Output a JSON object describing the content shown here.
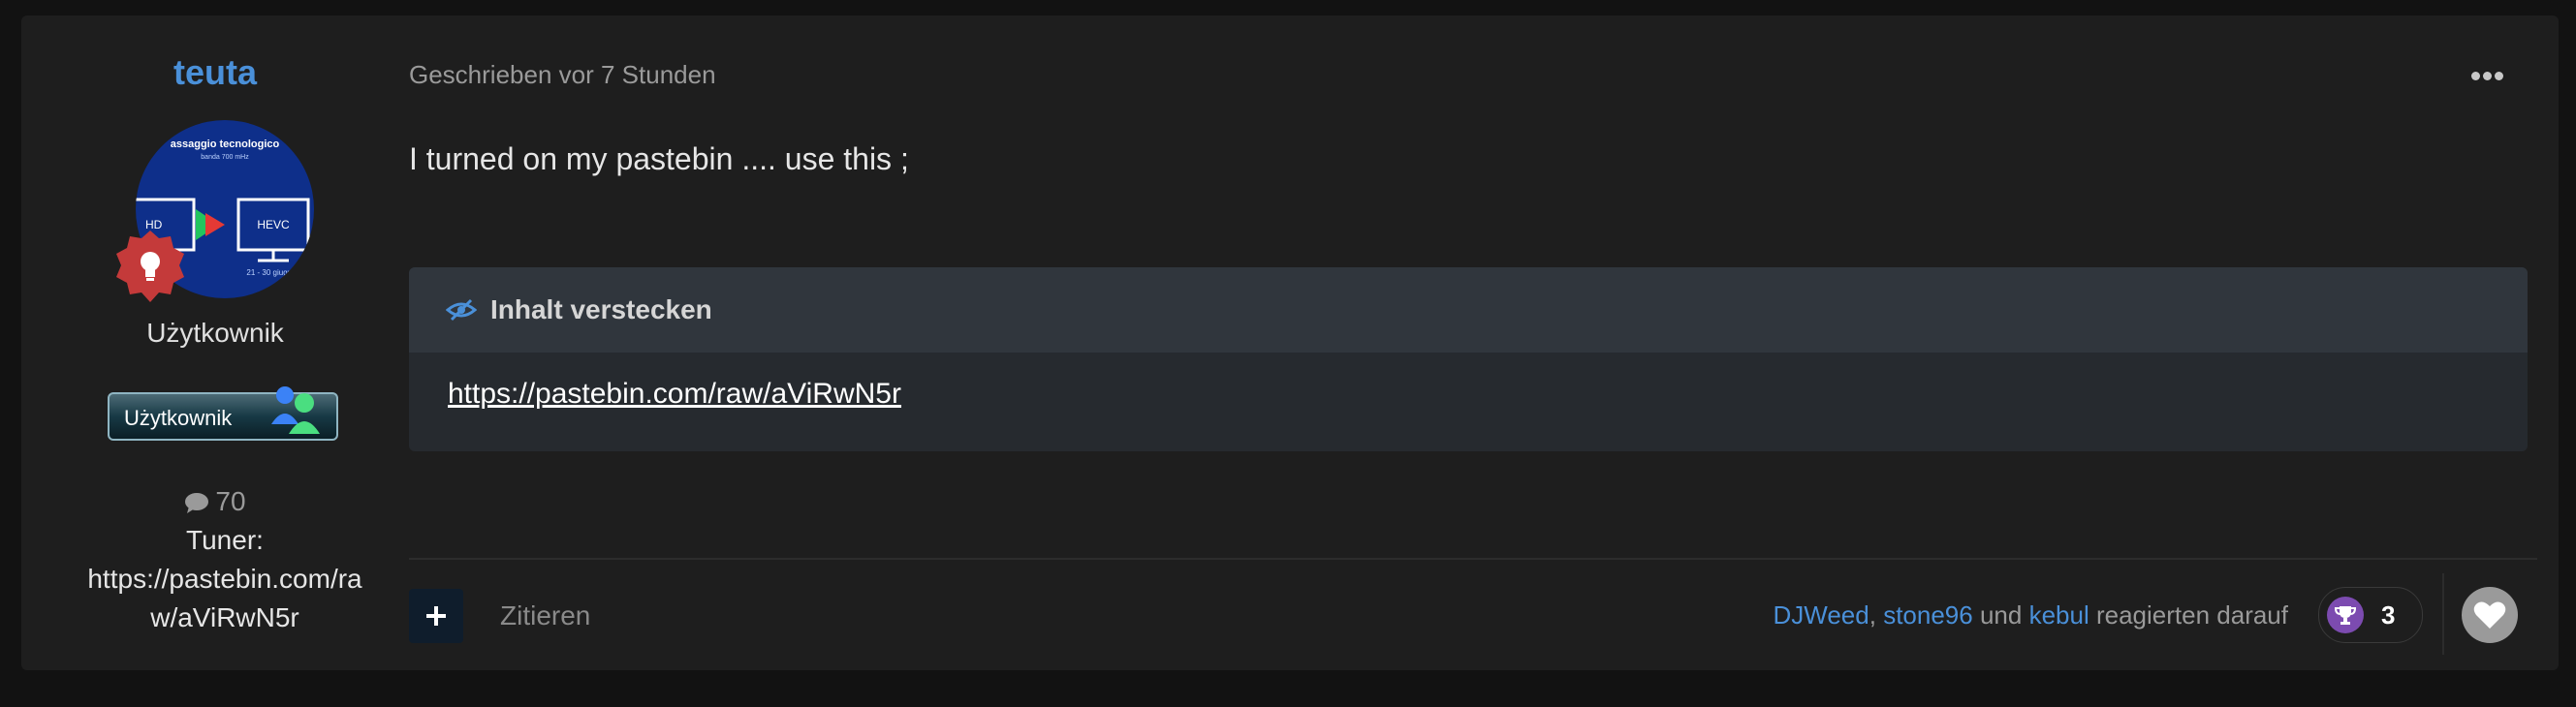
{
  "author": {
    "name": "teuta",
    "title": "Użytkownik",
    "group_badge_label": "Użytkownik",
    "post_count": "70",
    "profile_field_label": "Tuner:",
    "profile_field_value": "https://pastebin.com/raw/aViRwN5r",
    "avatar_text_top": "assaggio tecnologico",
    "avatar_text_sub": "banda 700 mHz",
    "avatar_text_left": "HD",
    "avatar_text_right": "HEVC",
    "avatar_text_bottom": "21 - 30 giugno"
  },
  "post": {
    "meta": "Geschrieben vor 7 Stunden",
    "body": "I turned on my pastebin .... use this ;",
    "hidden_box": {
      "title": "Inhalt verstecken",
      "link": "https://pastebin.com/raw/aViRwN5r"
    }
  },
  "footer": {
    "quote_label": "Zitieren",
    "reactors": [
      "DJWeed",
      "stone96",
      "kebul"
    ],
    "sep_comma": ",",
    "and_word": "und",
    "reacted_text": "reagierten darauf",
    "reaction_count": "3"
  },
  "icons": {
    "more": "more-options-icon",
    "comment": "comment-icon",
    "eye_slash": "eye-slash-icon",
    "plus": "plus-icon",
    "trophy": "trophy-icon",
    "heart": "heart-icon",
    "rank": "lightbulb-rank-icon"
  },
  "colors": {
    "accent": "#4a90d9",
    "background": "#1e1e1e",
    "reaction": "#7c4bb0"
  }
}
